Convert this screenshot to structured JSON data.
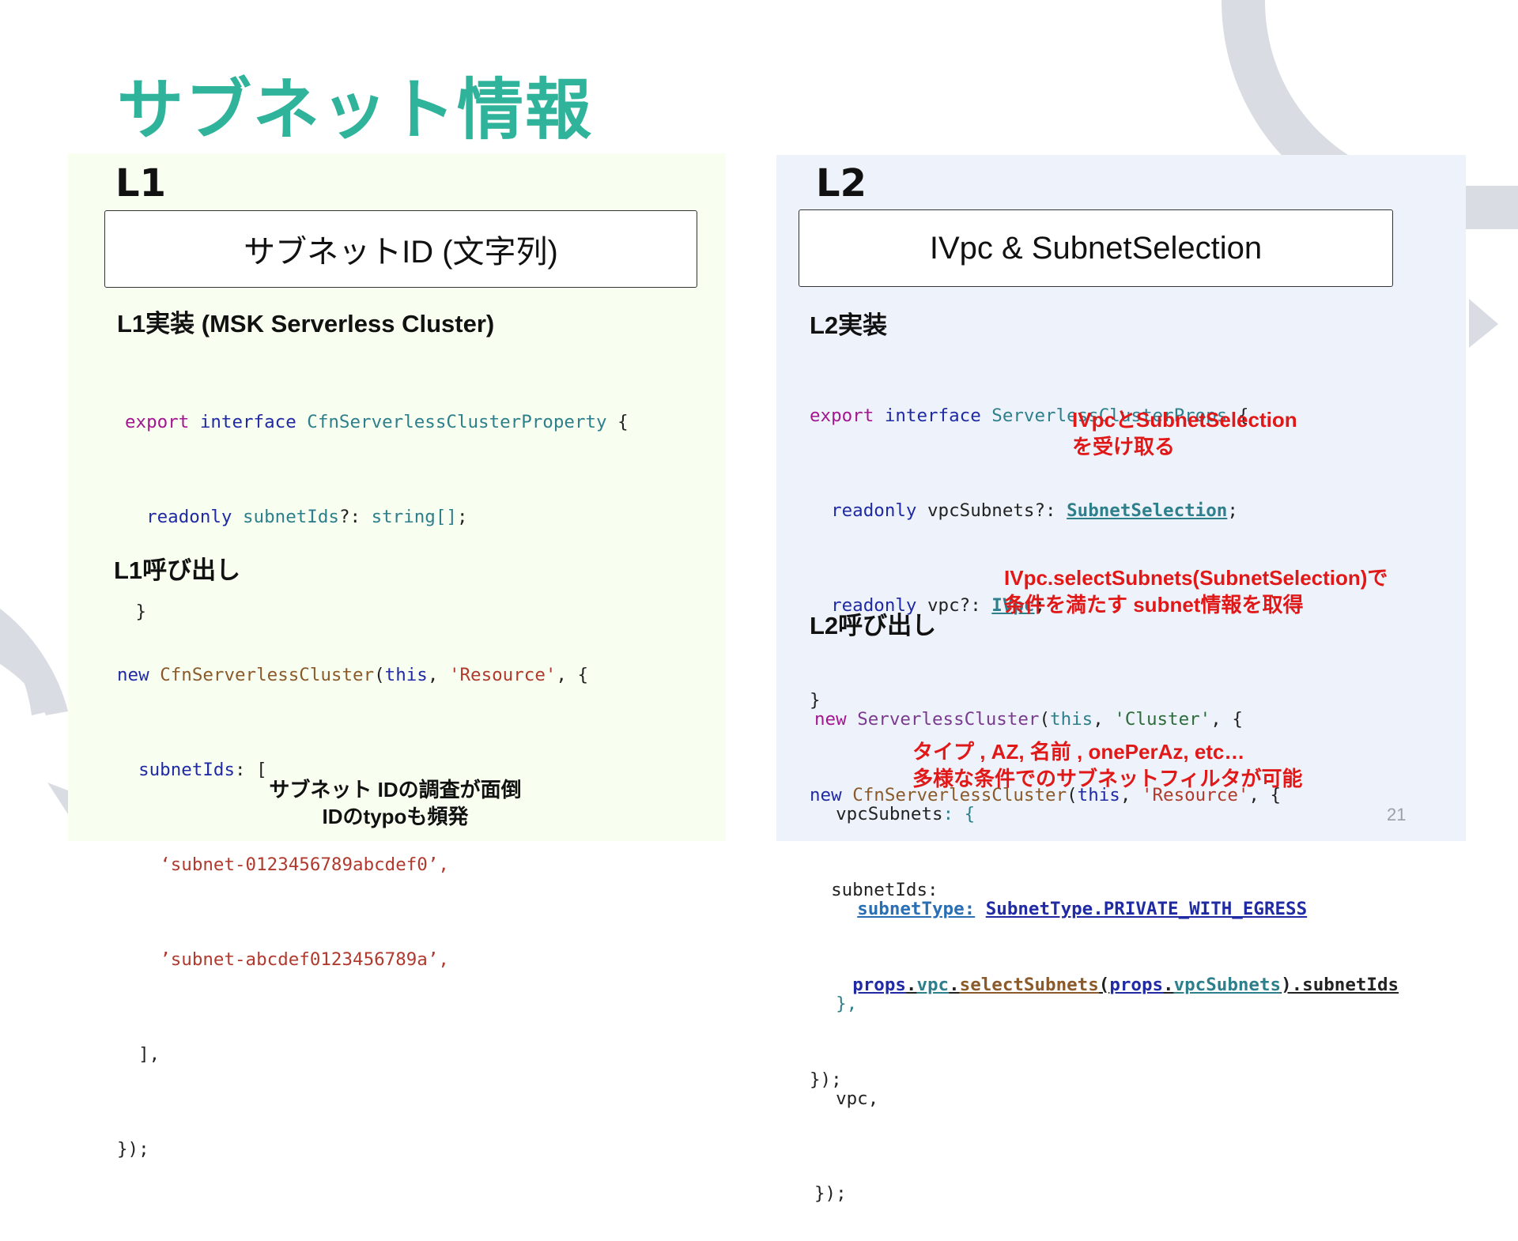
{
  "slide": {
    "title": "サブネット情報",
    "page_number": "21",
    "accent_color": "#2fb39a"
  },
  "l1": {
    "level_label": "L1",
    "box_text": "サブネットID (文字列)",
    "impl_heading": "L1実装 (MSK Serverless Cluster)",
    "impl_code": {
      "line1": {
        "kw": "export",
        "kw2": "interface",
        "name": "CfnServerlessClusterProperty",
        "brace": " {"
      },
      "line2": {
        "kw": "readonly",
        "prop": "subnetIds",
        "sep": "?: ",
        "type": "string[]",
        "end": ";"
      },
      "line3": "}"
    },
    "call_heading": "L1呼び出し",
    "call_code": {
      "line1": {
        "kw": "new",
        "cls": "CfnServerlessCluster",
        "open": "(",
        "this": "this",
        "sep": ", ",
        "str": "'Resource'",
        "end": ", {"
      },
      "line2": {
        "prop": "subnetIds",
        "rest": ": ["
      },
      "line3": "‘subnet-0123456789abcdef0’,",
      "line4": "’subnet-abcdef0123456789a’,",
      "line5": "],",
      "line6": "});"
    },
    "note_line1": "サブネット IDの調査が面倒",
    "note_line2": "IDのtypoも頻発"
  },
  "l2": {
    "level_label": "L2",
    "box_text": "IVpc & SubnetSelection",
    "impl_heading": "L2実装",
    "impl_code": {
      "line1": {
        "kw": "export",
        "kw2": "interface",
        "name": "ServerlessClusterProps",
        "brace": " {"
      },
      "line2": {
        "kw": "readonly",
        "prop": "vpcSubnets",
        "sep": "?: ",
        "type": "SubnetSelection",
        "end": ";"
      },
      "line3": {
        "kw": "readonly",
        "prop": "vpc",
        "sep": "?: ",
        "type": "IVpc",
        "end": ";"
      },
      "line4": "}",
      "line5": {
        "kw": "new",
        "cls": "CfnServerlessCluster",
        "open": "(",
        "this": "this",
        "sep": ", ",
        "str": "'Resource'",
        "end": ", {"
      },
      "line6": "subnetIds:",
      "line7": {
        "a": "props",
        "b": ".",
        "c": "vpc",
        "d": ".",
        "e": "selectSubnets",
        "f": "(",
        "g": "props",
        "h": ".",
        "i": "vpcSubnets",
        "j": ").subnetIds"
      },
      "line8": "});"
    },
    "impl_note_line1": "IVpcとSubnetSelection",
    "impl_note_line2": "を受け取る",
    "select_note_line1": "IVpc.selectSubnets(SubnetSelection)で",
    "select_note_line2": "条件を満たす subnet情報を取得",
    "call_heading": "L2呼び出し",
    "call_code": {
      "line1": {
        "kw": "new",
        "cls": "ServerlessCluster",
        "open": "(",
        "this": "this",
        "sep": ", ",
        "str": "'Cluster'",
        "end": ", {"
      },
      "line2": {
        "prop": "vpcSubnets",
        "rest": ": {"
      },
      "line3": {
        "key": "subnetType:",
        "val": "SubnetType.PRIVATE_WITH_EGRESS"
      },
      "line4": "},",
      "line5": "vpc,",
      "line6": "});"
    },
    "call_note_line1": "タイプ , AZ, 名前 , onePerAz, etc…",
    "call_note_line2": "多様な条件でのサブネットフィルタが可能"
  }
}
